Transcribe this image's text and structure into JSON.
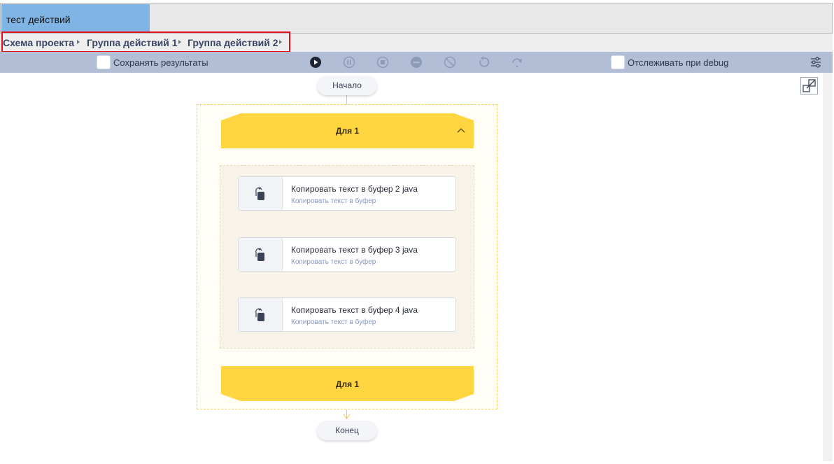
{
  "tab": {
    "title": "тест действий"
  },
  "breadcrumb": {
    "items": [
      "Схема проекта",
      "Группа действий 1",
      "Группа действий 2"
    ]
  },
  "toolbar": {
    "save_results_label": "Сохранять результаты",
    "track_debug_label": "Отслеживать при debug",
    "icons": [
      "play-icon",
      "pause-icon",
      "stop-icon",
      "minus-circle-icon",
      "disable-icon",
      "undo-icon",
      "redo-icon"
    ]
  },
  "flow": {
    "start_label": "Начало",
    "end_label": "Конец",
    "loop": {
      "head_label": "Для  1",
      "foot_label": "Для  1"
    },
    "actions": [
      {
        "title": "Копировать текст в буфер  2  java",
        "subtitle": "Копировать текст в буфер"
      },
      {
        "title": "Копировать текст в буфер  3  java",
        "subtitle": "Копировать текст в буфер"
      },
      {
        "title": "Копировать текст в буфер  4  java",
        "subtitle": "Копировать текст в буфер"
      }
    ]
  },
  "colors": {
    "tab_active": "#7fb4e4",
    "toolbar": "#b1bed5",
    "loop_yellow": "#ffd63f",
    "breadcrumb_highlight": "#e3101a",
    "breadcrumb_text": "#3a4664"
  }
}
